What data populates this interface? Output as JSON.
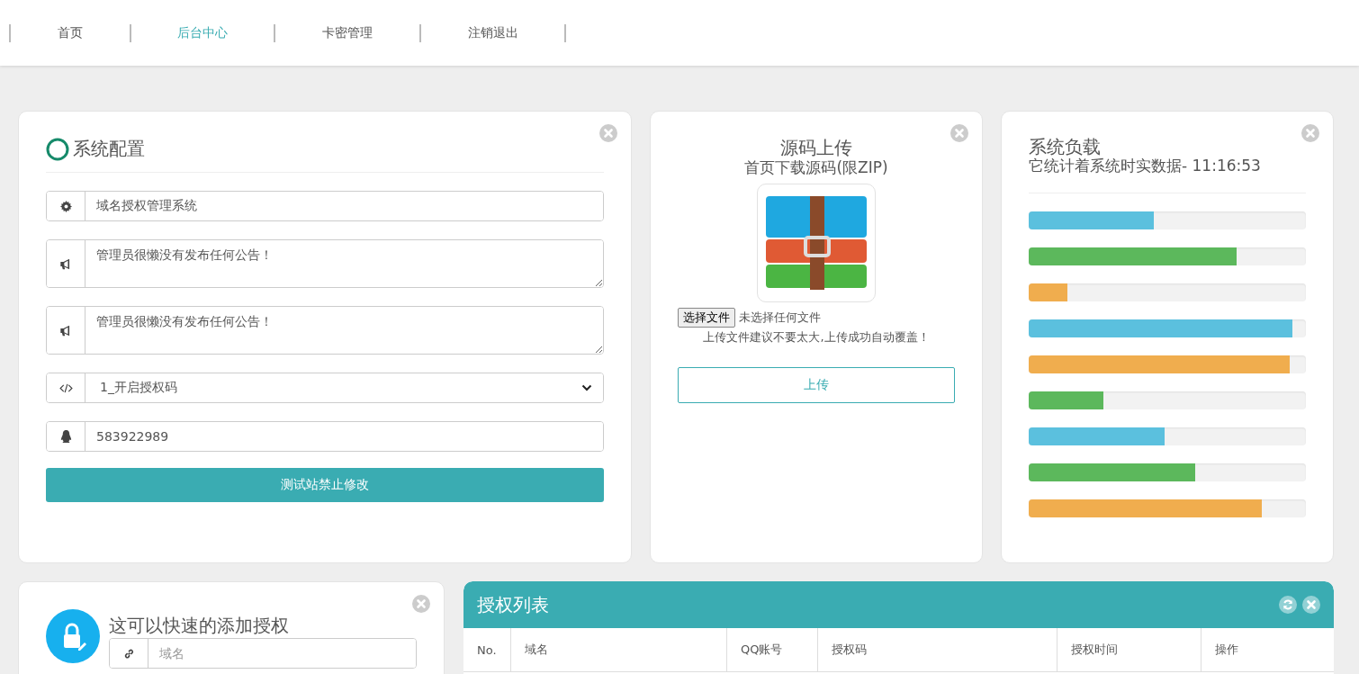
{
  "nav": [
    {
      "label": "首页",
      "selected": false
    },
    {
      "label": "后台中心",
      "selected": true
    },
    {
      "label": "卡密管理",
      "selected": false
    },
    {
      "label": "注销退出",
      "selected": false
    }
  ],
  "config_card": {
    "title": "系统配置",
    "fields": [
      {
        "kind": "input",
        "value": "域名授权管理系统"
      },
      {
        "kind": "textarea",
        "value": "管理员很懒没有发布任何公告！"
      },
      {
        "kind": "textarea",
        "value": "管理员很懒没有发布任何公告！"
      },
      {
        "kind": "select",
        "value": "1_开启授权码"
      },
      {
        "kind": "input",
        "value": "583922989"
      }
    ],
    "button": "测试站禁止修改"
  },
  "upload_card": {
    "title": "源码上传",
    "subtitle": "首页下载源码(限ZIP)",
    "file_button": "选择文件",
    "file_status": "未选择任何文件",
    "hint": "上传文件建议不要太大,上传成功自动覆盖！",
    "button": "上传"
  },
  "load_card": {
    "title": "系统负载",
    "subtitle": "它统计着系统时实数据- 11:16:53",
    "bars": [
      {
        "color": "#5bc0de",
        "level": 0.45
      },
      {
        "color": "#5cb85c",
        "level": 0.75
      },
      {
        "color": "#f0ad4e",
        "level": 0.14
      },
      {
        "color": "#5bc0de",
        "level": 0.95
      },
      {
        "color": "#f0ad4e",
        "level": 0.94
      },
      {
        "color": "#5cb85c",
        "level": 0.27
      },
      {
        "color": "#5bc0de",
        "level": 0.49
      },
      {
        "color": "#5cb85c",
        "level": 0.6
      },
      {
        "color": "#f0ad4e",
        "level": 0.84
      }
    ]
  },
  "add_card": {
    "title": "这可以快速的添加授权",
    "placeholder": "域名"
  },
  "list_card": {
    "title": "授权列表",
    "columns": [
      "No.",
      "域名",
      "QQ账号",
      "授权码",
      "授权时间",
      "操作"
    ]
  }
}
